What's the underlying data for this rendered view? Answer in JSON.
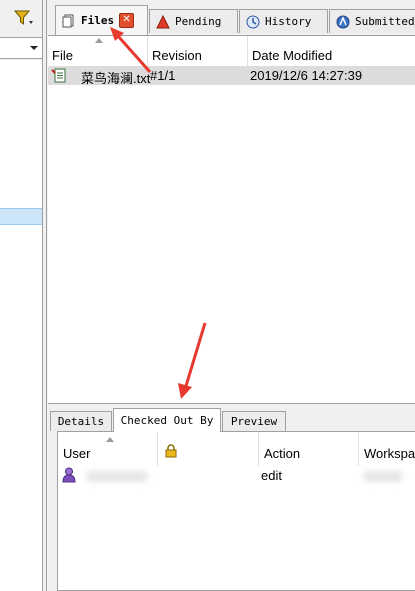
{
  "tabs": [
    {
      "label": "Files",
      "icon": "files-icon"
    },
    {
      "label": "Pending",
      "icon": "pending-icon"
    },
    {
      "label": "History",
      "icon": "history-icon"
    },
    {
      "label": "Submitted",
      "icon": "submitted-icon"
    }
  ],
  "files_table": {
    "columns": [
      "File",
      "Revision",
      "Date Modified"
    ],
    "rows": [
      {
        "file": "菜鸟海澜.txt",
        "revision": "#1/1",
        "date_modified": "2019/12/6 14:27:39"
      }
    ]
  },
  "bottom_tabs": [
    "Details",
    "Checked Out By",
    "Preview"
  ],
  "checked_out_table": {
    "columns": [
      "User",
      "",
      "Action",
      "Workspace"
    ],
    "rows": [
      {
        "user": "",
        "action": "edit",
        "workspace": ""
      }
    ]
  },
  "colors": {
    "annotation_arrow": "#e8392f",
    "selected_row": "#dcdcdc",
    "tree_selection": "#cce4f7"
  }
}
